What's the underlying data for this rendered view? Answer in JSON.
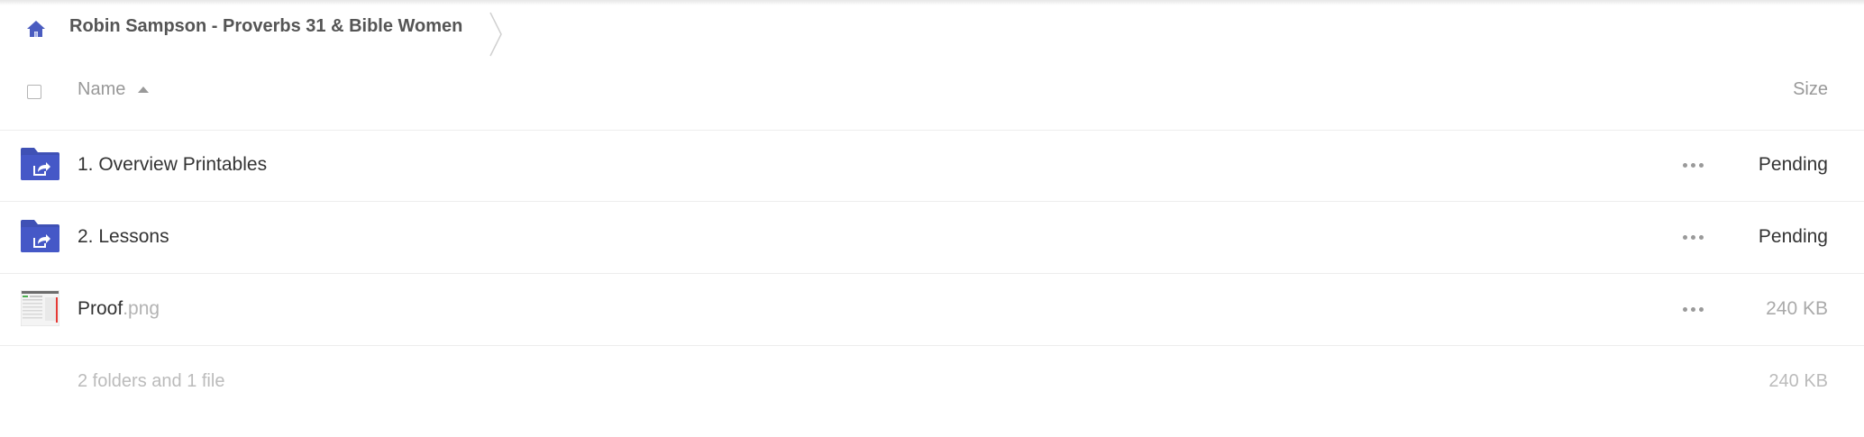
{
  "breadcrumb": {
    "home_icon": "home-icon",
    "current": "Robin Sampson - Proverbs 31 & Bible Women"
  },
  "header": {
    "name_label": "Name",
    "size_label": "Size",
    "sort_icon": "sort-ascending-icon"
  },
  "files": [
    {
      "name": "1. Overview Printables",
      "ext": "",
      "icon": "shared-folder-icon",
      "size": "Pending"
    },
    {
      "name": "2. Lessons",
      "ext": "",
      "icon": "shared-folder-icon",
      "size": "Pending"
    },
    {
      "name": "Proof",
      "ext": ".png",
      "icon": "image-thumbnail",
      "size": "240 KB"
    }
  ],
  "summary": {
    "text": "2 folders and 1 file",
    "size": "240 KB"
  },
  "colors": {
    "accent": "#3f51b5",
    "muted_text": "#999999"
  }
}
